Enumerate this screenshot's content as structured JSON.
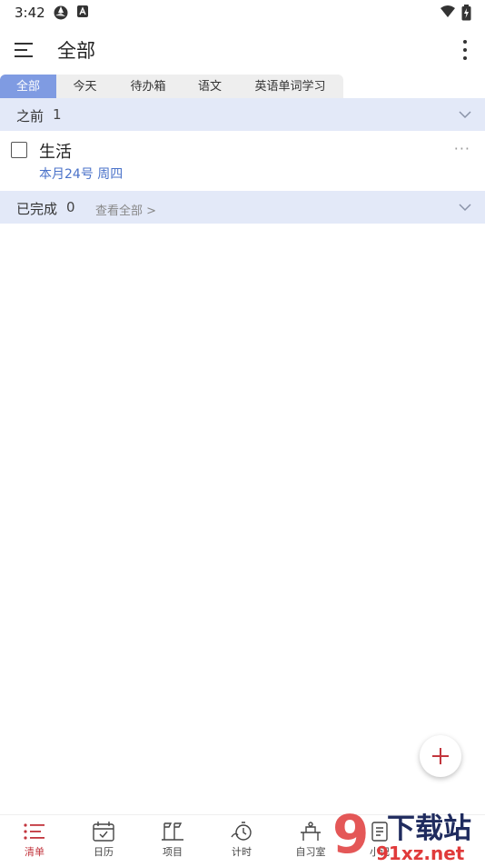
{
  "status_bar": {
    "time": "3:42"
  },
  "app_bar": {
    "title": "全部"
  },
  "tabs": [
    {
      "label": "全部",
      "active": true
    },
    {
      "label": "今天",
      "active": false
    },
    {
      "label": "待办箱",
      "active": false
    },
    {
      "label": "语文",
      "active": false
    },
    {
      "label": "英语单词学习",
      "active": false
    }
  ],
  "sections": {
    "before": {
      "label": "之前",
      "count": "1"
    },
    "done": {
      "label": "已完成",
      "count": "0",
      "view_all": "查看全部 >"
    }
  },
  "task": {
    "name": "生活",
    "date": "本月24号 周四",
    "more": "···"
  },
  "bottom_nav": [
    {
      "label": "清单",
      "icon": "list-icon",
      "active": true
    },
    {
      "label": "日历",
      "icon": "calendar-icon",
      "active": false
    },
    {
      "label": "项目",
      "icon": "project-icon",
      "active": false
    },
    {
      "label": "计时",
      "icon": "timer-icon",
      "active": false
    },
    {
      "label": "自习室",
      "icon": "study-room-icon",
      "active": false
    },
    {
      "label": "小记",
      "icon": "note-icon",
      "active": false
    }
  ],
  "watermark": {
    "text": "下载站",
    "url_text": "91xz.net",
    "number": "9"
  },
  "colors": {
    "accent": "#7f9be2",
    "section_bg": "#e3e9f8",
    "active_nav": "#c2353d",
    "date_blue": "#4a72c9"
  }
}
